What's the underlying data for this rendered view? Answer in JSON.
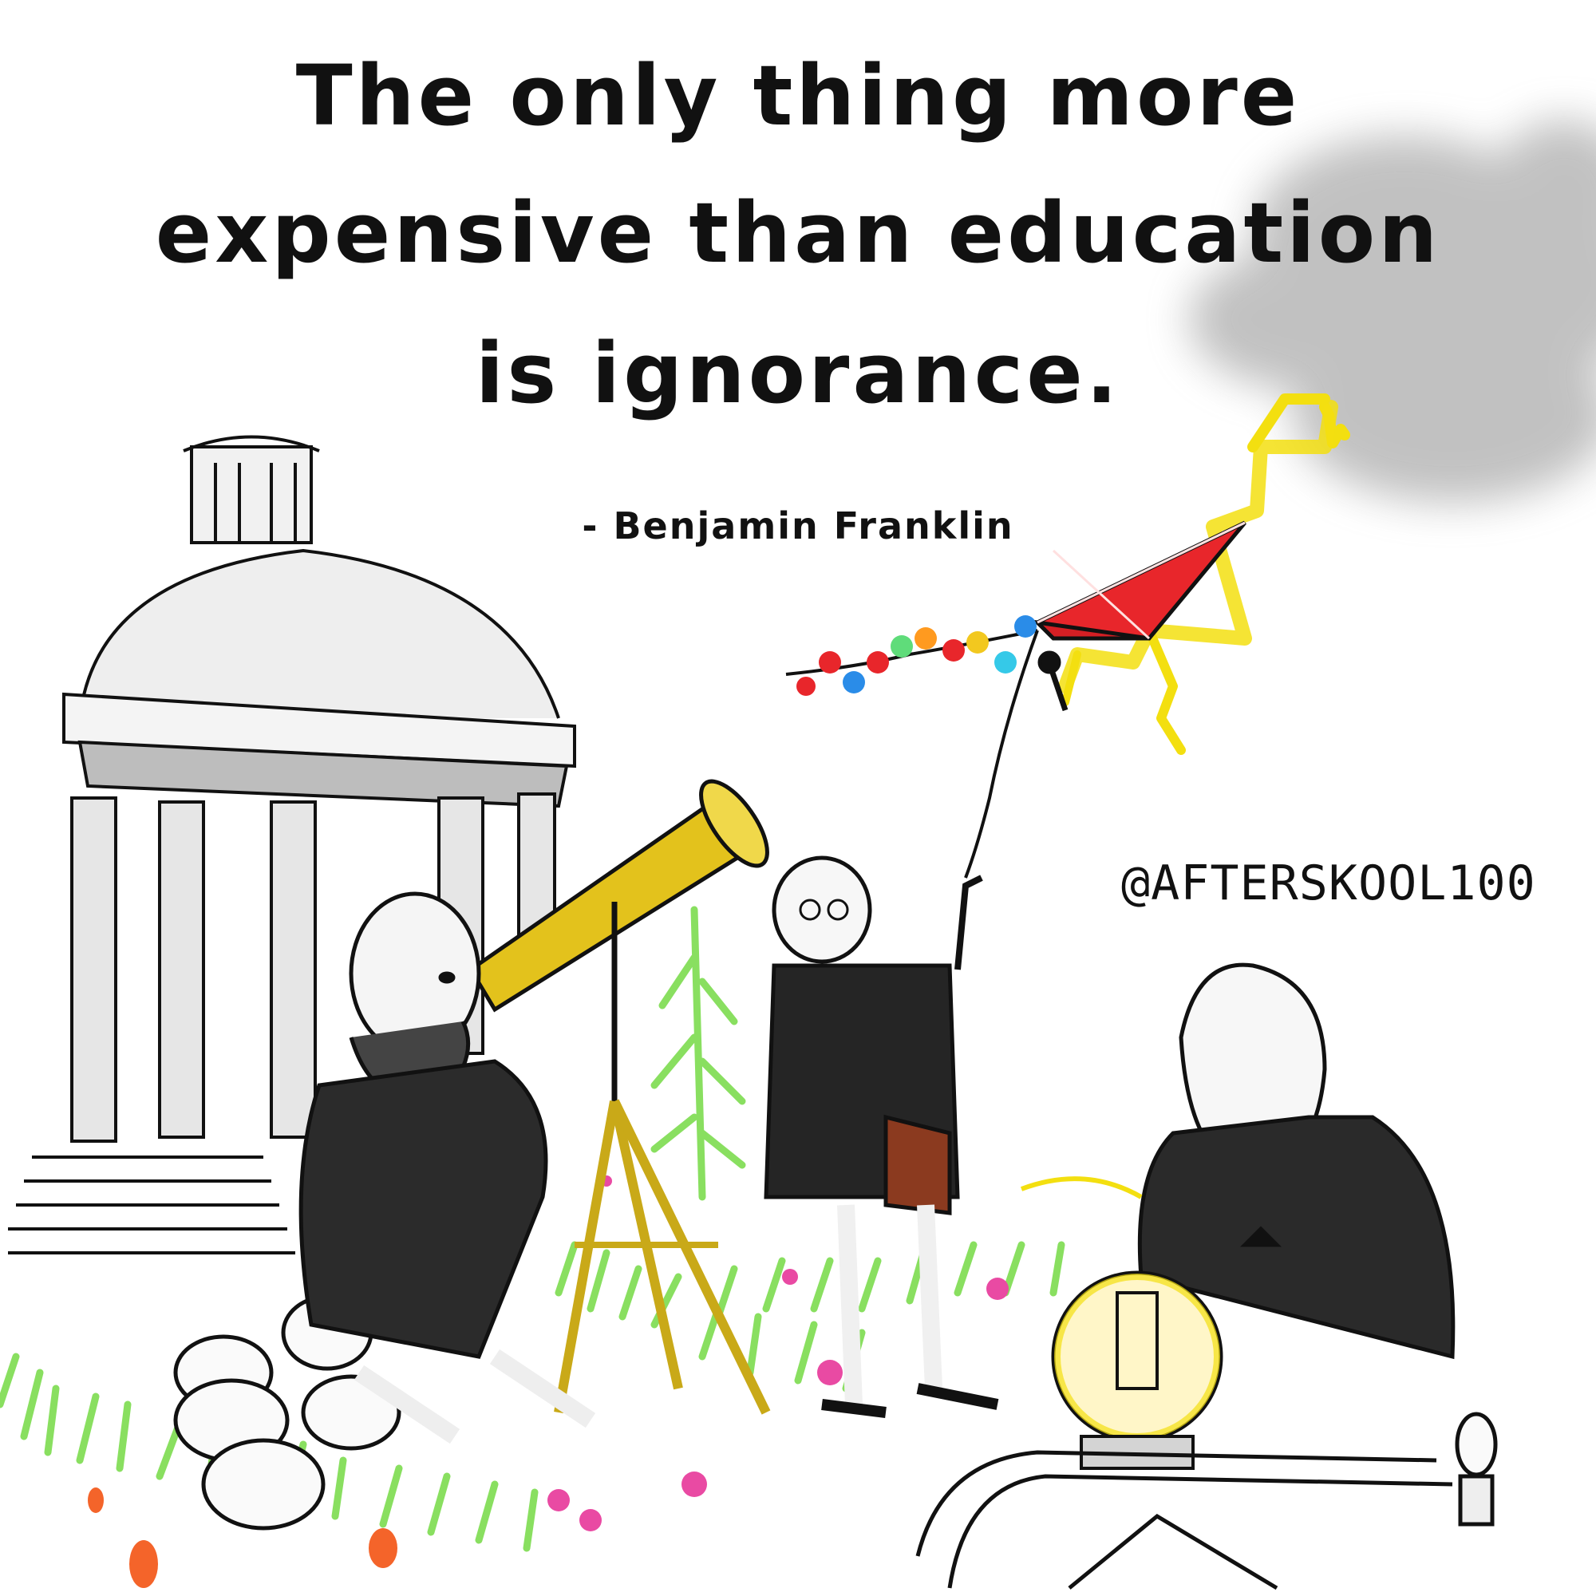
{
  "quote": {
    "line1": "The only thing more",
    "line2": "expensive than education",
    "line3": "is ignorance."
  },
  "attribution": "- Benjamin Franklin",
  "handle": "@AFTERSKOOL100",
  "colors": {
    "ink": "#111111",
    "kite_red": "#e8262b",
    "lightning_yellow": "#f7e21a",
    "telescope_gold": "#e3c21c",
    "grass_green": "#7ddc4f",
    "cloud_gray": "#9a9a9a",
    "flower_pink": "#e94aa3"
  }
}
